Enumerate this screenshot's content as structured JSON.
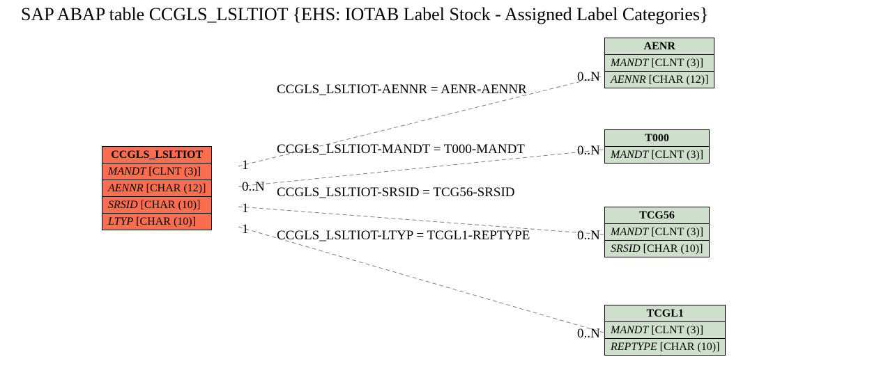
{
  "title": "SAP ABAP table CCGLS_LSLTIOT {EHS: IOTAB Label Stock - Assigned Label Categories}",
  "main": {
    "name": "CCGLS_LSLTIOT",
    "fields": [
      {
        "name": "MANDT",
        "type": "[CLNT (3)]"
      },
      {
        "name": "AENNR",
        "type": "[CHAR (12)]"
      },
      {
        "name": "SRSID",
        "type": "[CHAR (10)]"
      },
      {
        "name": "LTYP",
        "type": "[CHAR (10)]"
      }
    ]
  },
  "targets": {
    "aenr": {
      "name": "AENR",
      "fields": [
        {
          "name": "MANDT",
          "type": "[CLNT (3)]"
        },
        {
          "name": "AENNR",
          "type": "[CHAR (12)]"
        }
      ]
    },
    "t000": {
      "name": "T000",
      "fields": [
        {
          "name": "MANDT",
          "type": "[CLNT (3)]"
        }
      ]
    },
    "tcg56": {
      "name": "TCG56",
      "fields": [
        {
          "name": "MANDT",
          "type": "[CLNT (3)]"
        },
        {
          "name": "SRSID",
          "type": "[CHAR (10)]"
        }
      ]
    },
    "tcgl1": {
      "name": "TCGL1",
      "fields": [
        {
          "name": "MANDT",
          "type": "[CLNT (3)]"
        },
        {
          "name": "REPTYPE",
          "type": "[CHAR (10)]"
        }
      ]
    }
  },
  "rel": {
    "r1": "CCGLS_LSLTIOT-AENNR = AENR-AENNR",
    "r2": "CCGLS_LSLTIOT-MANDT = T000-MANDT",
    "r3": "CCGLS_LSLTIOT-SRSID = TCG56-SRSID",
    "r4": "CCGLS_LSLTIOT-LTYP = TCGL1-REPTYPE"
  },
  "card": {
    "left1": "1",
    "left2": "0..N",
    "left3": "1",
    "left4": "1",
    "right": "0..N"
  }
}
